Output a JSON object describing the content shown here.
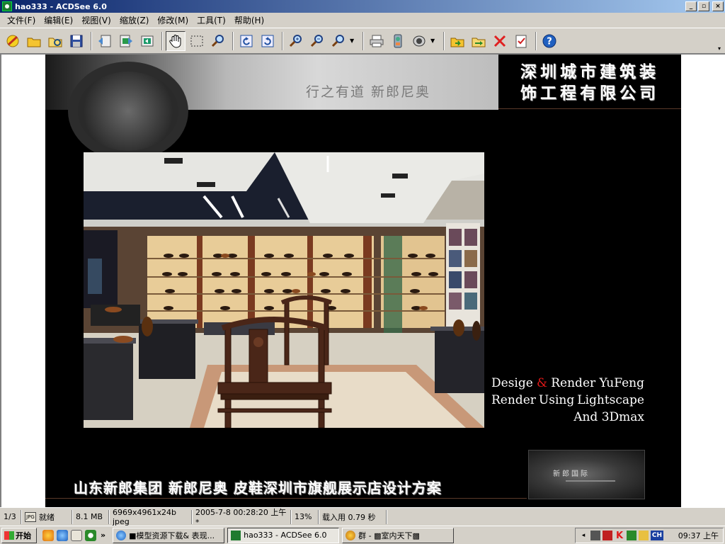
{
  "window": {
    "title": "hao333 - ACDSee 6.0",
    "buttons": [
      "_",
      "▫",
      "×"
    ]
  },
  "menu": [
    "文件(F)",
    "编辑(E)",
    "视图(V)",
    "缩放(Z)",
    "修改(M)",
    "工具(T)",
    "帮助(H)"
  ],
  "toolbar": {
    "icons": [
      "acquire-icon",
      "open-icon",
      "browse-icon",
      "save-icon",
      "previous-icon",
      "next-icon",
      "sync-icon",
      "hand-tool-icon",
      "select-tool-icon",
      "zoom-tool-icon",
      "rotate-left-icon",
      "rotate-right-icon",
      "zoom-in-icon",
      "zoom-out-icon",
      "zoom-fit-icon",
      "print-icon",
      "slideshow-icon",
      "audio-icon",
      "copy-to-folder-icon",
      "move-to-folder-icon",
      "delete-icon",
      "properties-icon",
      "help-icon"
    ],
    "active": "hand-tool-icon"
  },
  "image": {
    "slogan": "行之有道  新郎尼奥",
    "company_line1": "深圳城市建筑装",
    "company_line2": "饰工程有限公司",
    "credits": {
      "w1": "Desige",
      "amp": "&",
      "w2": "Render YuFeng",
      "l2a": "Render",
      "l2b": "Using",
      "l2c": "Lightscape",
      "l3": "And 3Dmax"
    },
    "logo_text": "新郎国际",
    "caption": "山东新郎集团 新郎尼奥 皮鞋深圳市旗舰展示店设计方案"
  },
  "status": {
    "index": "1/3",
    "icon_label": "JPG",
    "state": "就绪",
    "size": "8.1 MB",
    "dimensions": "6969x4961x24b jpeg",
    "modified": "2005-7-8 00:28:20 上午*",
    "zoom": "13%",
    "load_time": "载入用 0.79 秒"
  },
  "taskbar": {
    "start": "开始",
    "chevron": "»",
    "tasks": [
      {
        "label": "■模型资源下载& 表现...",
        "active": false
      },
      {
        "label": "hao333 - ACDSee 6.0",
        "active": true
      },
      {
        "label": "群 - ▩室内天下▩",
        "active": false
      }
    ],
    "tray_lang": "CH",
    "tray_k": "K",
    "clock": "09:37 上午"
  },
  "colors": {
    "title_start": "#0a246a",
    "title_end": "#a6caf0",
    "chrome": "#d4d0c8",
    "accent_red": "#e01818"
  }
}
